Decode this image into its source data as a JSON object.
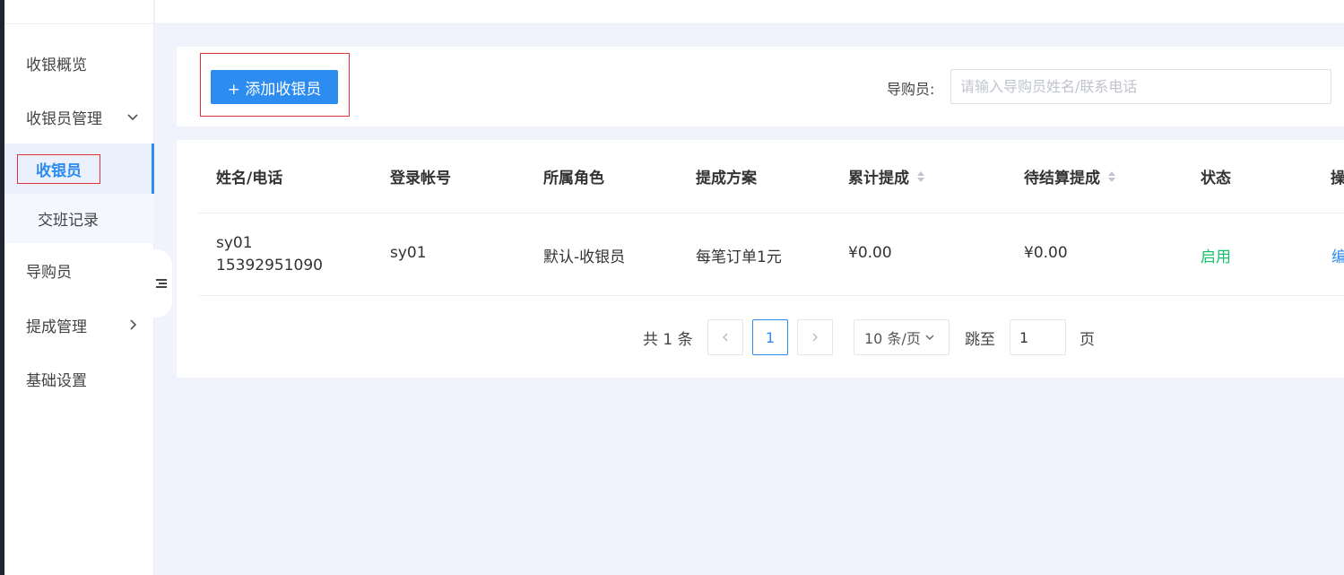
{
  "sidebar": {
    "items": [
      {
        "label": "收银概览"
      },
      {
        "label": "收银员管理"
      },
      {
        "label": "收银员"
      },
      {
        "label": "交班记录"
      },
      {
        "label": "导购员"
      },
      {
        "label": "提成管理"
      },
      {
        "label": "基础设置"
      }
    ]
  },
  "toolbar": {
    "add_label": "+ 添加收银员",
    "search_label": "导购员:",
    "search_placeholder": "请输入导购员姓名/联系电话",
    "search_value": ""
  },
  "table": {
    "columns": [
      "姓名/电话",
      "登录帐号",
      "所属角色",
      "提成方案",
      "累计提成",
      "待结算提成",
      "状态",
      "操"
    ],
    "rows": [
      {
        "name": "sy01",
        "phone": "15392951090",
        "account": "sy01",
        "role": "默认-收银员",
        "plan": "每笔订单1元",
        "total": "¥0.00",
        "pending": "¥0.00",
        "status": "启用",
        "action": "编"
      }
    ]
  },
  "pagination": {
    "total_text": "共 1 条",
    "current_page": "1",
    "page_size": "10 条/页",
    "jump_label": "跳至",
    "jump_value": "1",
    "page_label": "页"
  },
  "colors": {
    "primary": "#2d8cf0",
    "status_enabled": "#19be6b",
    "highlight_border": "#e0323a",
    "background": "#f0f3fb"
  }
}
